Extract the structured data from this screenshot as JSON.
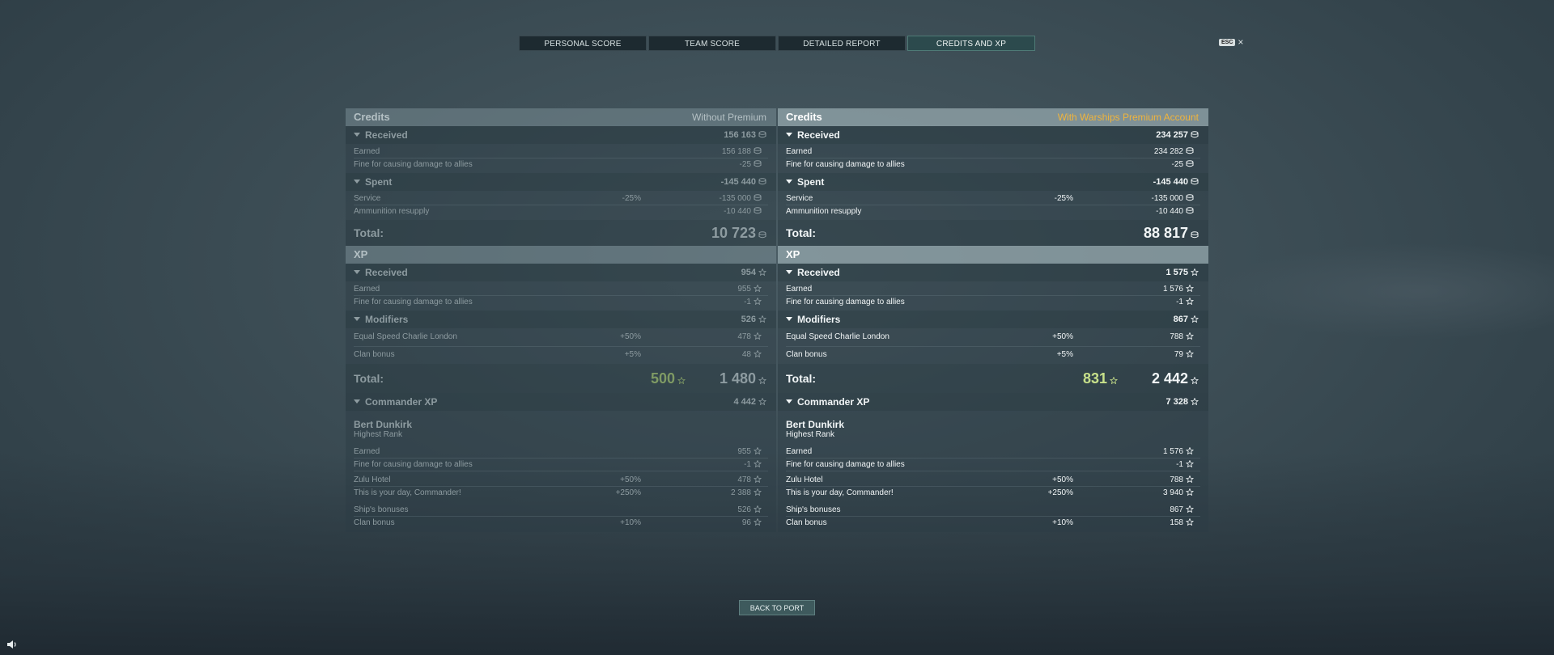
{
  "tabs": [
    {
      "label": "PERSONAL SCORE"
    },
    {
      "label": "TEAM SCORE"
    },
    {
      "label": "DETAILED REPORT"
    },
    {
      "label": "CREDITS AND XP",
      "active": true
    }
  ],
  "esc": {
    "badge": "ESC",
    "close": "×"
  },
  "left": {
    "credits_title": "Credits",
    "credits_tag": "Without Premium",
    "received_label": "Received",
    "received_value": "156 163",
    "earned_label": "Earned",
    "earned_value": "156 188",
    "fine_label": "Fine for causing damage to allies",
    "fine_value": "-25",
    "spent_label": "Spent",
    "spent_value": "-145 440",
    "service_label": "Service",
    "service_pct": "-25%",
    "service_value": "-135 000",
    "ammo_label": "Ammunition resupply",
    "ammo_value": "-10 440",
    "total_label": "Total:",
    "total_value": "10 723",
    "xp_title": "XP",
    "xp_received_label": "Received",
    "xp_received_value": "954",
    "xp_earned_label": "Earned",
    "xp_earned_value": "955",
    "xp_fine_label": "Fine for causing damage to allies",
    "xp_fine_value": "-1",
    "modifiers_label": "Modifiers",
    "modifiers_value": "526",
    "mod1_label": "Equal Speed Charlie London",
    "mod1_pct": "+50%",
    "mod1_value": "478",
    "mod2_label": "Clan bonus",
    "mod2_pct": "+5%",
    "mod2_value": "48",
    "xp_total_label": "Total:",
    "xp_total_free": "500",
    "xp_total_value": "1 480",
    "cmd_label": "Commander XP",
    "cmd_value": "4 442",
    "cmd_name": "Bert Dunkirk",
    "cmd_rank": "Highest Rank",
    "c_earned_label": "Earned",
    "c_earned_value": "955",
    "c_fine_label": "Fine for causing damage to allies",
    "c_fine_value": "-1",
    "c_zulu_label": "Zulu Hotel",
    "c_zulu_pct": "+50%",
    "c_zulu_value": "478",
    "c_day_label": "This is your day, Commander!",
    "c_day_pct": "+250%",
    "c_day_value": "2 388",
    "c_ship_label": "Ship's bonuses",
    "c_ship_value": "526",
    "c_clan_label": "Clan bonus",
    "c_clan_pct": "+10%",
    "c_clan_value": "96"
  },
  "right": {
    "credits_title": "Credits",
    "credits_tag": "With Warships Premium Account",
    "received_label": "Received",
    "received_value": "234 257",
    "earned_label": "Earned",
    "earned_value": "234 282",
    "fine_label": "Fine for causing damage to allies",
    "fine_value": "-25",
    "spent_label": "Spent",
    "spent_value": "-145 440",
    "service_label": "Service",
    "service_pct": "-25%",
    "service_value": "-135 000",
    "ammo_label": "Ammunition resupply",
    "ammo_value": "-10 440",
    "total_label": "Total:",
    "total_value": "88 817",
    "xp_title": "XP",
    "xp_received_label": "Received",
    "xp_received_value": "1 575",
    "xp_earned_label": "Earned",
    "xp_earned_value": "1 576",
    "xp_fine_label": "Fine for causing damage to allies",
    "xp_fine_value": "-1",
    "modifiers_label": "Modifiers",
    "modifiers_value": "867",
    "mod1_label": "Equal Speed Charlie London",
    "mod1_pct": "+50%",
    "mod1_value": "788",
    "mod2_label": "Clan bonus",
    "mod2_pct": "+5%",
    "mod2_value": "79",
    "xp_total_label": "Total:",
    "xp_total_free": "831",
    "xp_total_value": "2 442",
    "cmd_label": "Commander XP",
    "cmd_value": "7 328",
    "cmd_name": "Bert Dunkirk",
    "cmd_rank": "Highest Rank",
    "c_earned_label": "Earned",
    "c_earned_value": "1 576",
    "c_fine_label": "Fine for causing damage to allies",
    "c_fine_value": "-1",
    "c_zulu_label": "Zulu Hotel",
    "c_zulu_pct": "+50%",
    "c_zulu_value": "788",
    "c_day_label": "This is your day, Commander!",
    "c_day_pct": "+250%",
    "c_day_value": "3 940",
    "c_ship_label": "Ship's bonuses",
    "c_ship_value": "867",
    "c_clan_label": "Clan bonus",
    "c_clan_pct": "+10%",
    "c_clan_value": "158"
  },
  "footer": {
    "back_label": "BACK TO PORT"
  },
  "icons": {
    "credits": "credits-coin-icon",
    "xp": "xp-star-icon",
    "free_xp": "free-xp-star-icon",
    "sound": "speaker-icon"
  },
  "colors": {
    "premium": "#f0b43c",
    "free_xp_right": "#c7e08a",
    "free_xp_left": "#7f9a64",
    "active_tab": "#2c4a4d"
  }
}
